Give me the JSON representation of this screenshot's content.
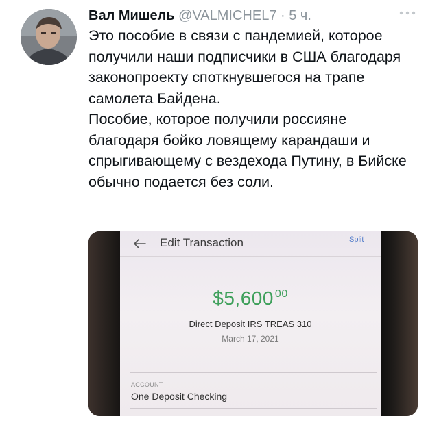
{
  "tweet": {
    "author_name": "Вал Мишель",
    "handle": "@VALMICHEL7",
    "separator": " · ",
    "time": "5 ч.",
    "text_paragraphs": [
      "Это пособие в связи с пандемией, которое получили наши подписчики в США благодаря законопроекту споткнувшегося на трапе самолета Байдена.",
      "Пособие, которое получили россияне благодаря бойко ловящему карандаши и спрыгивающему с вездехода Путину, в Бийске обычно подается без соли."
    ],
    "more_icon": "more-horizontal-icon"
  },
  "media": {
    "screen_title": "Edit Transaction",
    "split_label": "Split",
    "amount_main": "$5,600",
    "amount_cents": "00",
    "description": "Direct Deposit IRS TREAS 310",
    "date": "March 17, 2021",
    "account_label": "ACCOUNT",
    "account_value": "One Deposit Checking",
    "back_icon": "arrow-left-icon"
  },
  "colors": {
    "text_primary": "#0f1419",
    "text_secondary": "#8c959c",
    "amount_green": "#3fa05c",
    "link_blue": "#4b77c8"
  }
}
